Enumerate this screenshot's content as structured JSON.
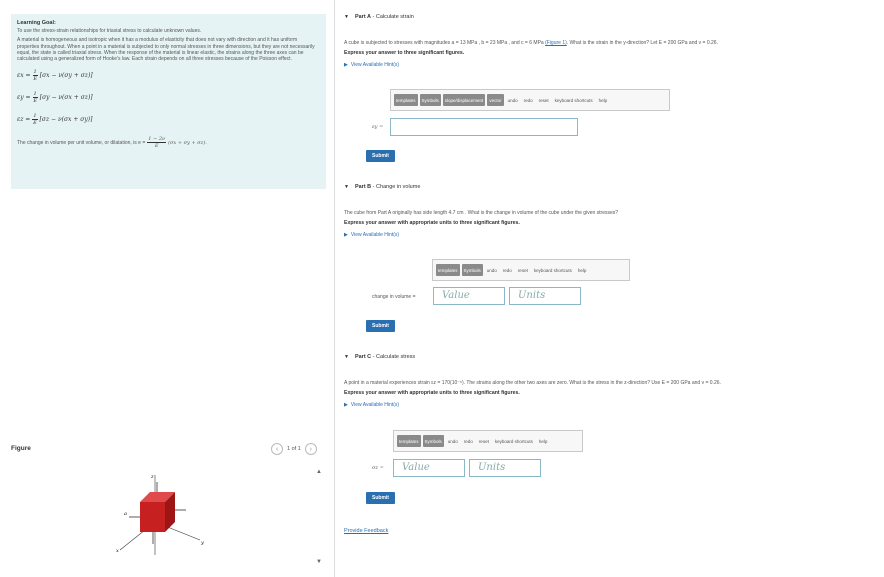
{
  "goal": {
    "title": "Learning Goal:",
    "intro": "To use the stress-strain relationships for triaxial stress to calculate unknown values.",
    "body": "A material is homogeneous and isotropic when it has a modulus of elasticity that does not vary with direction and it has uniform properties throughout. When a point in a material is subjected to only normal stresses in three dimensions, but they are not necessarily equal, the state is called triaxial stress. When the response of the material is linear elastic, the strains along the three axes can be calculated using a generalized form of Hooke's law. Each strain depends on all three stresses because of the Poisson effect.",
    "eq1_lhs": "εx = ",
    "eq1_rhs": "[σx − ν(σy + σz)]",
    "eq2_lhs": "εy = ",
    "eq2_rhs": "[σy − ν(σx + σz)]",
    "eq3_lhs": "εz = ",
    "eq3_rhs": "[σz − ν(σx + σy)]",
    "frac_num": "1",
    "frac_den": "E",
    "volume_text": "The change in volume per unit volume, or dilatation, is e = ",
    "vol_num": "1 − 2ν",
    "vol_den": "E",
    "vol_rhs": "(σx + σy + σz)."
  },
  "figure": {
    "label": "Figure",
    "pager": "1 of 1",
    "prev": "‹",
    "next": "›",
    "axis_x": "x",
    "axis_y": "y",
    "axis_z": "z",
    "stress_a": "a"
  },
  "partA": {
    "title": "Part A",
    "subtitle": "Calculate strain",
    "text": "A cube is subjected to stresses with magnitudes a = 13 MPa , b = 23 MPa , and c = 6 MPa",
    "link": "(Figure 1)",
    "text2": ". What is the strain in the y-direction? Let E = 200 GPa and ν = 0.26.",
    "instruction": "Express your answer to three significant figures.",
    "hints": "View Available Hint(s)",
    "input_label": "εy =",
    "submit": "Submit",
    "tools": [
      "templates",
      "Symbols",
      "slope/displacement",
      "vector",
      "undo",
      "redo",
      "reset",
      "keyboard shortcuts",
      "help"
    ]
  },
  "partB": {
    "title": "Part B",
    "subtitle": "Change in volume",
    "text": "The cube from Part A originally has side length 4.7 cm . What is the change in volume of the cube under the given stresses?",
    "instruction": "Express your answer with appropriate units to three significant figures.",
    "hints": "View Available Hint(s)",
    "input_label": "change in volume =",
    "value_placeholder": "Value",
    "units_placeholder": "Units",
    "submit": "Submit",
    "tools": [
      "templates",
      "Symbols",
      "undo",
      "redo",
      "reset",
      "keyboard shortcuts",
      "help"
    ]
  },
  "partC": {
    "title": "Part C",
    "subtitle": "Calculate stress",
    "text": "A point in a material experiences strain εz = 170(10⁻⁶). The strains along the other two axes are zero. What is the stress in the z-direction? Use E = 200 GPa and ν = 0.26.",
    "instruction": "Express your answer with appropriate units to three significant figures.",
    "hints": "View Available Hint(s)",
    "input_label": "σz =",
    "value_placeholder": "Value",
    "units_placeholder": "Units",
    "submit": "Submit",
    "tools": [
      "templates",
      "Symbols",
      "undo",
      "redo",
      "reset",
      "keyboard shortcuts",
      "help"
    ]
  },
  "feedback": "Provide Feedback",
  "colors": {
    "accent": "#2a6fb0",
    "goal_bg": "#e6f3f4",
    "cube": "#d42a2a"
  }
}
